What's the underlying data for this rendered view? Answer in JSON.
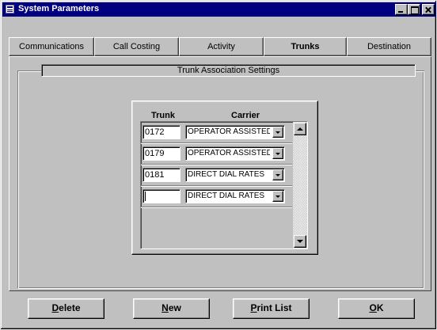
{
  "window": {
    "title": "System Parameters",
    "titlebar_color": "#000080",
    "face_color": "#c0c0c0"
  },
  "tabs": [
    {
      "label": "Communications",
      "active": false
    },
    {
      "label": "Call Costing",
      "active": false
    },
    {
      "label": "Activity",
      "active": false
    },
    {
      "label": "Trunks",
      "active": true
    },
    {
      "label": "Destination",
      "active": false
    }
  ],
  "group": {
    "title": "Trunk Association Settings"
  },
  "grid": {
    "headers": {
      "trunk": "Trunk",
      "carrier": "Carrier"
    },
    "rows": [
      {
        "trunk": "0172",
        "carrier": "OPERATOR ASSISTED"
      },
      {
        "trunk": "0179",
        "carrier": "OPERATOR ASSISTED"
      },
      {
        "trunk": "0181",
        "carrier": "DIRECT DIAL RATES"
      },
      {
        "trunk": "",
        "carrier": "DIRECT DIAL RATES"
      }
    ]
  },
  "actions": {
    "delete": {
      "accel": "D",
      "rest": "elete"
    },
    "new": {
      "accel": "N",
      "rest": "ew"
    },
    "print": {
      "accel": "P",
      "rest": "rint List"
    },
    "ok": {
      "accel": "O",
      "rest": "K"
    }
  }
}
